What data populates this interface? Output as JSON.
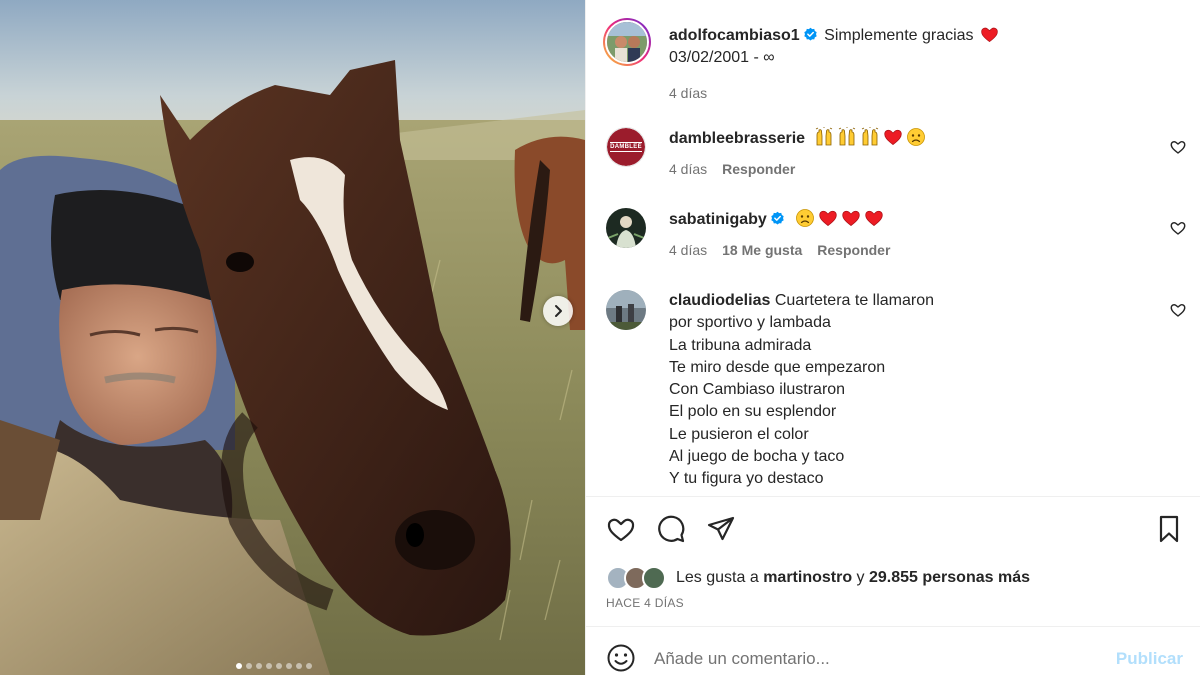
{
  "post": {
    "author": "adolfocambiaso1",
    "caption_text": "Simplemente gracias",
    "caption_date": "03/02/2001 - ∞",
    "time": "4 días"
  },
  "comments": [
    {
      "user": "dambleebrasserie",
      "avatar_text": "DAMBLEÉ",
      "time": "4 días",
      "reply": "Responder",
      "emojis": [
        "raised-hands-icon",
        "raised-hands-icon",
        "raised-hands-icon",
        "red-heart-icon",
        "sad-face-icon"
      ]
    },
    {
      "user": "sabatinigaby",
      "time": "4 días",
      "likes": "18 Me gusta",
      "reply": "Responder",
      "emojis": [
        "sad-face-icon",
        "red-heart-icon",
        "red-heart-icon",
        "red-heart-icon"
      ]
    },
    {
      "user": "claudiodelias",
      "text_first": "Cuartetera te llamaron",
      "lines": [
        "por sportivo y lambada",
        "La tribuna admirada",
        "Te miro desde que empezaron",
        "Con Cambiaso ilustraron",
        "El polo en su esplendor",
        "Le pusieron el color",
        "Al juego de bocha y taco",
        "Y tu figura yo destaco"
      ]
    }
  ],
  "likes_summary": {
    "prefix": "Les gusta a",
    "user": "martinostro",
    "conj": "y",
    "count": "29.855 personas más"
  },
  "time_caption": "HACE 4 DÍAS",
  "comment_box": {
    "placeholder": "Añade un comentario...",
    "publish": "Publicar"
  },
  "carousel": {
    "slides": 8,
    "active_index": 0
  },
  "colors": {
    "heart": "#ed1c24",
    "verified": "#0095f6",
    "publish_disabled": "#b2dffc",
    "meta_gray": "#737373",
    "avatar_ring": [
      "#f9ce34",
      "#ee2a7b",
      "#6228d7"
    ]
  }
}
